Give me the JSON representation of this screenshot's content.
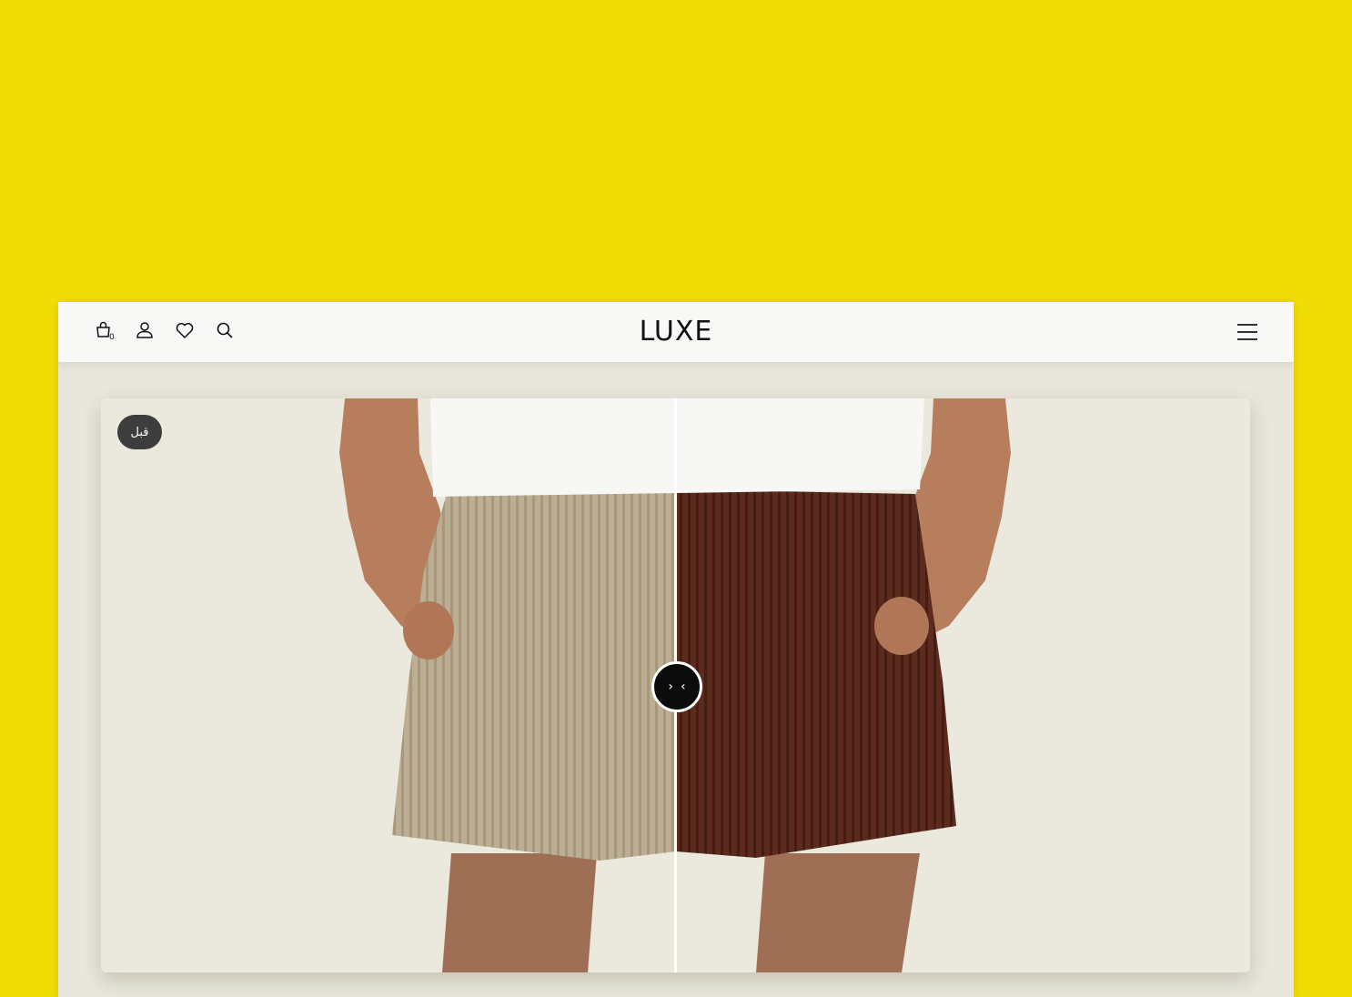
{
  "header": {
    "logo": "LUXE",
    "cart_count": "0",
    "icons": [
      "cart-icon",
      "user-icon",
      "heart-icon",
      "search-icon",
      "menu-icon"
    ]
  },
  "compare": {
    "before_label": "قبل",
    "handle_left": "‹",
    "handle_right": "›"
  },
  "colors": {
    "background": "#f1dd06",
    "page": "#e9e6dc",
    "before_shorts": "#b9ab90",
    "after_shorts": "#5a2a1d"
  }
}
